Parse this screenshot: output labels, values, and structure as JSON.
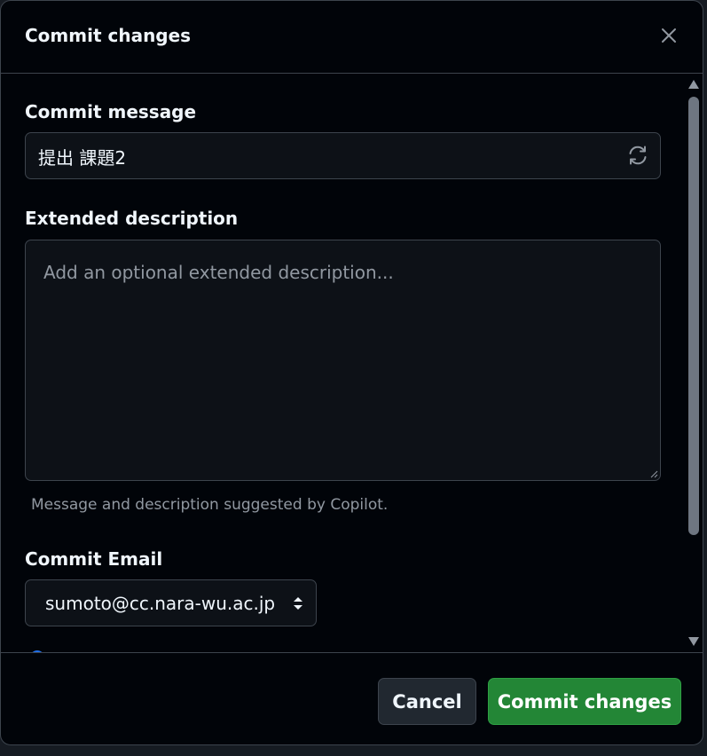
{
  "dialog": {
    "title": "Commit changes",
    "close_icon": "close-icon"
  },
  "commit_message": {
    "label": "Commit message",
    "value": "提出 課題2",
    "regenerate_icon": "refresh-icon"
  },
  "extended_description": {
    "label": "Extended description",
    "placeholder": "Add an optional extended description...",
    "value": ""
  },
  "hint": "Message and description suggested by Copilot.",
  "commit_email": {
    "label": "Commit Email",
    "selected": "sumoto@cc.nara-wu.ac.jp"
  },
  "footer": {
    "cancel_label": "Cancel",
    "commit_label": "Commit changes"
  },
  "colors": {
    "background": "#010409",
    "border": "#3d444d",
    "text": "#f0f6fc",
    "muted": "#9198a1",
    "primary_button": "#238636"
  }
}
